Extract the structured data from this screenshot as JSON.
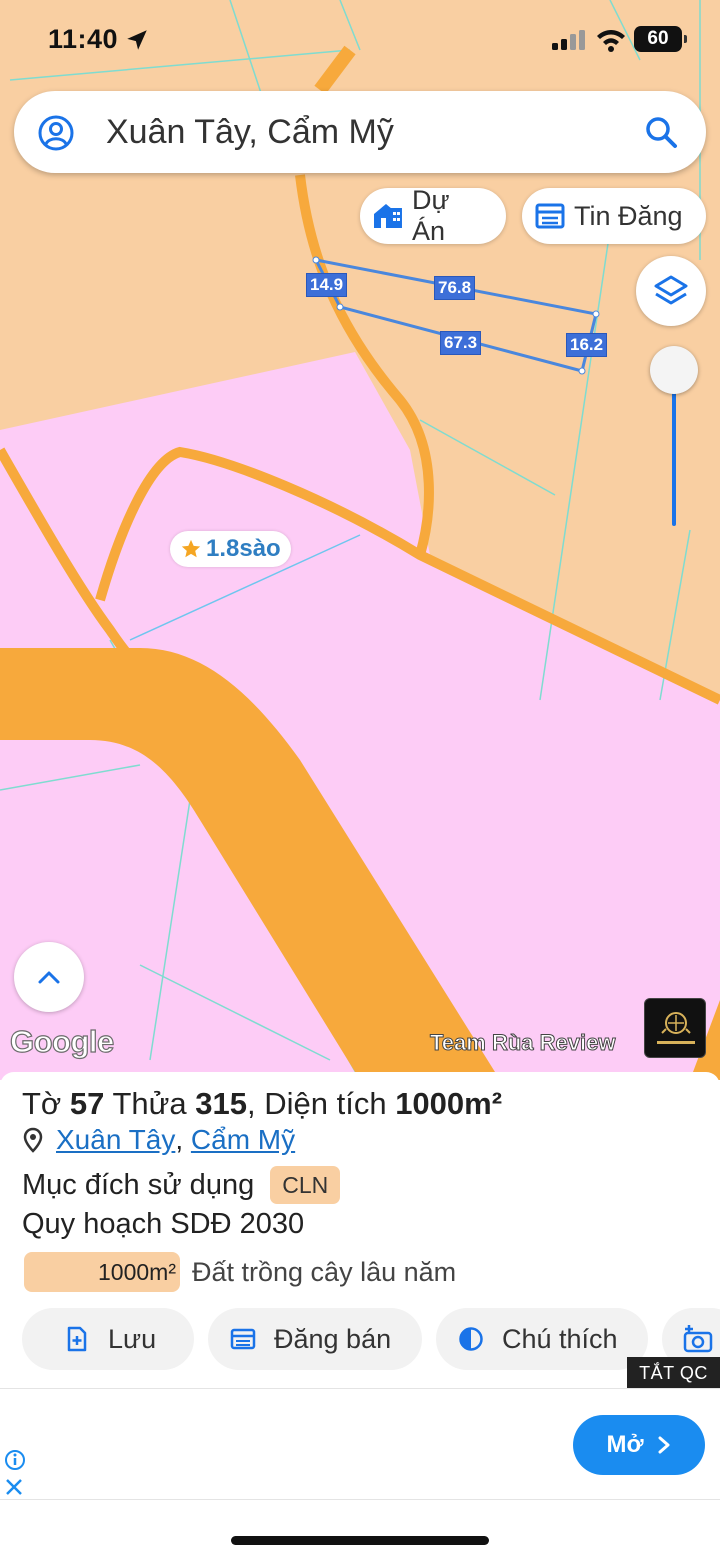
{
  "status_bar": {
    "time": "11:40",
    "battery": "60"
  },
  "search": {
    "text": "Xuân Tây, Cẩm Mỹ"
  },
  "chips": {
    "du_an": "Dự Án",
    "tin_dang": "Tin Đăng"
  },
  "map": {
    "dimensions": [
      "14.9",
      "76.8",
      "67.3",
      "16.2"
    ],
    "area_label": "1.8sào",
    "google_logo": "Google",
    "watermark": "Team Rùa Review",
    "colors": {
      "land_orange": "#f9cfa2",
      "land_pink": "#fdccf6",
      "road": "#f7a93c",
      "parcel_line": "#4a87dd"
    }
  },
  "parcel": {
    "to_label": "Tờ",
    "to_value": "57",
    "thua_label": "Thửa",
    "thua_value": "315",
    "area_label": "Diện tích",
    "area_value": "1000m²",
    "address_commune": "Xuân Tây",
    "address_separator": ",",
    "address_district": "Cẩm Mỹ",
    "purpose_label": "Mục đích sử dụng",
    "purpose_code": "CLN",
    "plan_label": "Quy hoạch SDĐ 2030",
    "legend_value": "1000m²",
    "legend_text": "Đất trồng cây lâu năm"
  },
  "actions": {
    "save": "Lưu",
    "post": "Đăng bán",
    "legend": "Chú thích"
  },
  "ad": {
    "close_tag": "TẮT QC",
    "open_label": "Mở"
  }
}
